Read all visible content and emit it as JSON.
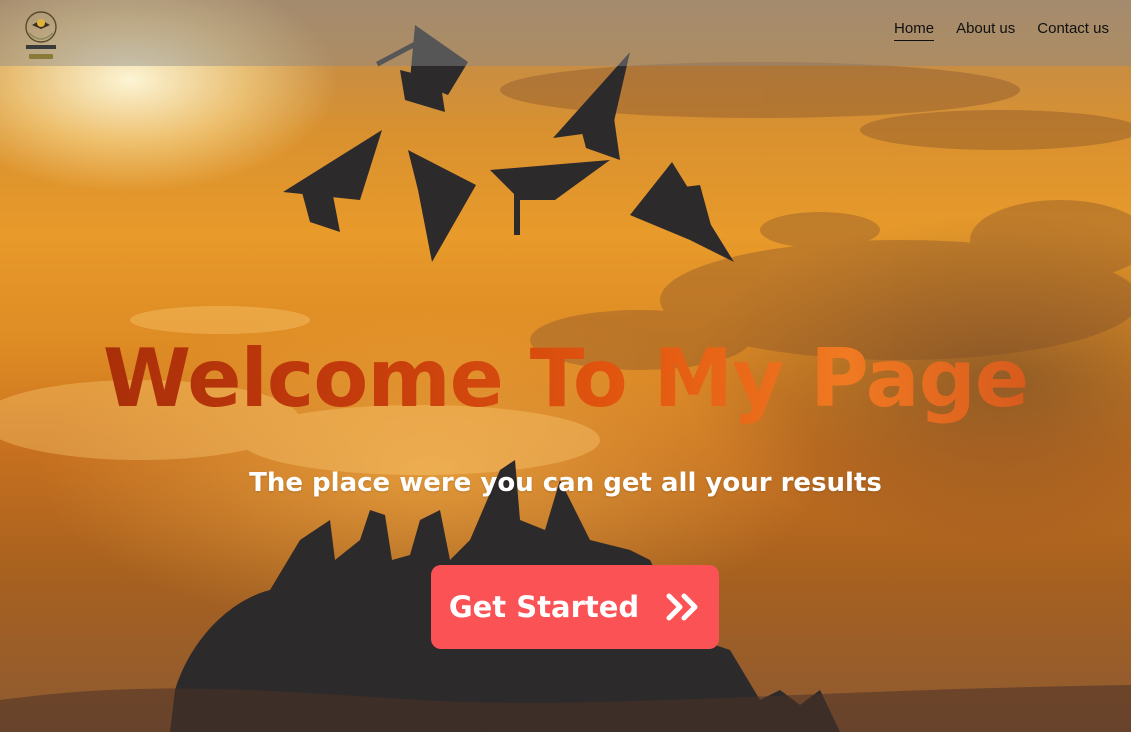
{
  "logo": {
    "text": "SMART STUDENT",
    "icon": "graduation-logo-icon"
  },
  "nav": {
    "items": [
      {
        "label": "Home",
        "active": true
      },
      {
        "label": "About us",
        "active": false
      },
      {
        "label": "Contact us",
        "active": false
      }
    ]
  },
  "hero": {
    "title": "Welcome To My Page",
    "subtitle": "The place were you can get all your results",
    "cta_label": "Get Started",
    "cta_icon": "double-chevron-right-icon",
    "background": "graduation-caps-sunset-photo"
  },
  "colors": {
    "cta": "#fb5256",
    "title": "#c23a0c",
    "subtitle": "#ffffff",
    "navbar": "rgba(140,140,140,0.45)"
  }
}
